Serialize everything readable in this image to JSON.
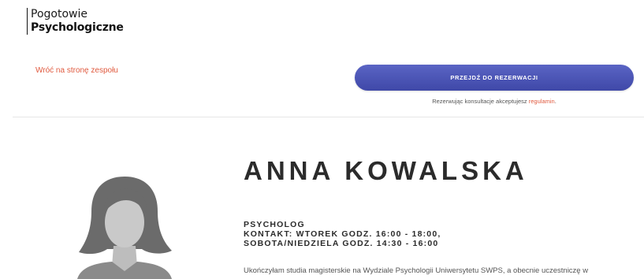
{
  "logo": {
    "line1": "Pogotowie",
    "line2": "Psychologiczne"
  },
  "nav": {
    "back_label": "Wróć na stronę zespołu"
  },
  "booking": {
    "button_label": "PRZEJDŹ DO REZERWACJI",
    "terms_prefix": "Rezerwując konsultacje akceptujesz",
    "terms_link": "regulamin",
    "terms_suffix": "."
  },
  "profile": {
    "name": "ANNA KOWALSKA",
    "role": "PSYCHOLOG",
    "contact_line1": "KONTAKT: WTOREK GODZ. 16:00 - 18:00,",
    "contact_line2": "SOBOTA/NIEDZIELA GODZ. 14:30 - 16:00",
    "bio": "Ukończyłam studia magisterskie na Wydziale Psychologii Uniwersytetu SWPS, a obecnie uczestniczę w",
    "avatar_icon": "person-placeholder-icon"
  },
  "colors": {
    "accent": "#e05a3f",
    "button": "#4a53b5",
    "text": "#2b2b2b"
  }
}
